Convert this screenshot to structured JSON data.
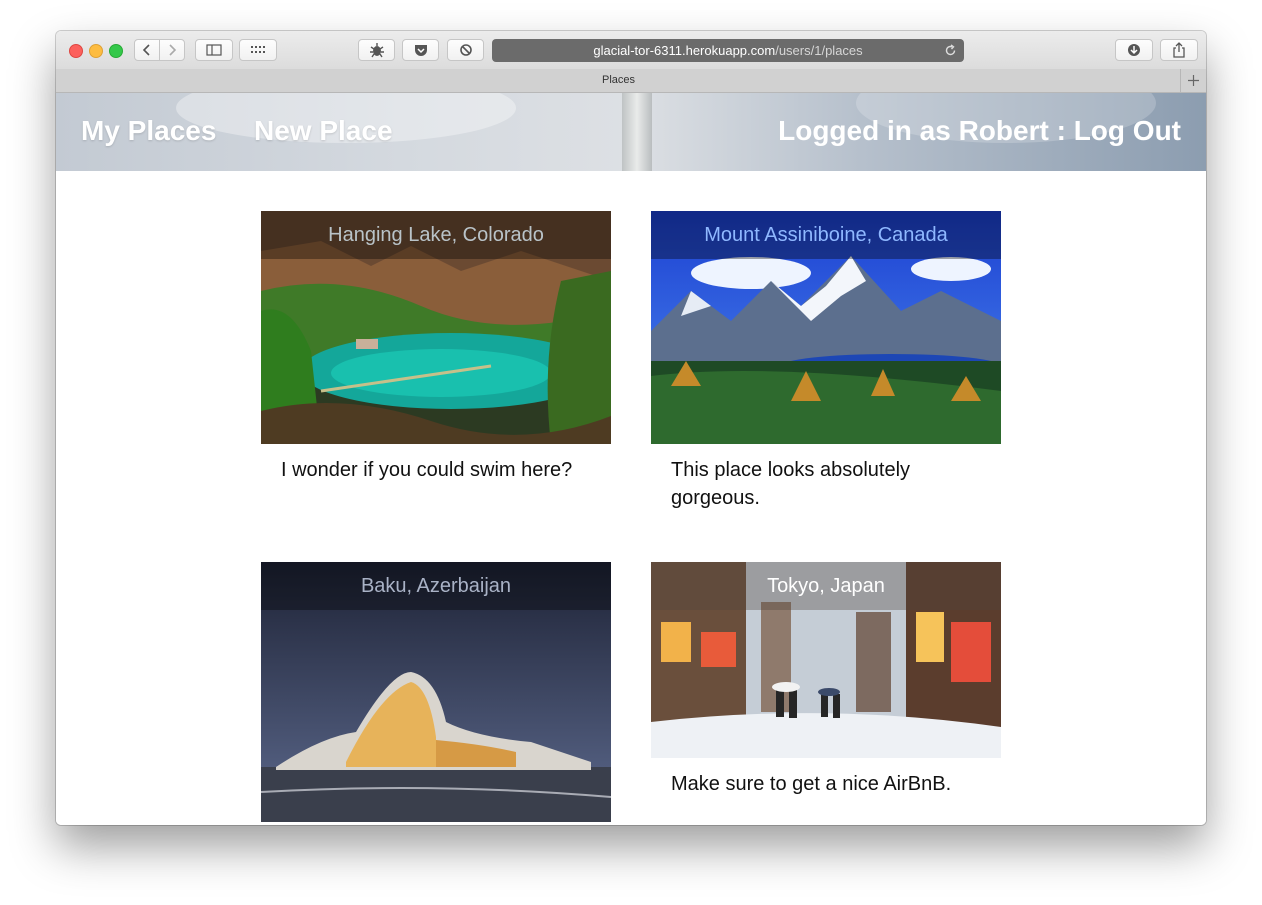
{
  "browser": {
    "url_host": "glacial-tor-6311.herokuapp.com",
    "url_path": "/users/1/places",
    "tab_title": "Places"
  },
  "nav": {
    "my_places": "My Places",
    "new_place": "New Place",
    "logged_in": "Logged in as Robert",
    "separator": ":",
    "log_out": "Log Out"
  },
  "places": [
    {
      "title": "Hanging Lake, Colorado",
      "description": "I wonder if you could swim here?",
      "title_color": "#b9c3c8"
    },
    {
      "title": "Mount Assiniboine, Canada",
      "description": "This place looks absolutely gorgeous.",
      "title_color": "#8fb8ff"
    },
    {
      "title": "Baku, Azerbaijan",
      "description": "",
      "title_color": "#a9b2c6"
    },
    {
      "title": "Tokyo, Japan",
      "description": "Make sure to get a nice AirBnB.",
      "title_color": "#ffffff"
    }
  ]
}
